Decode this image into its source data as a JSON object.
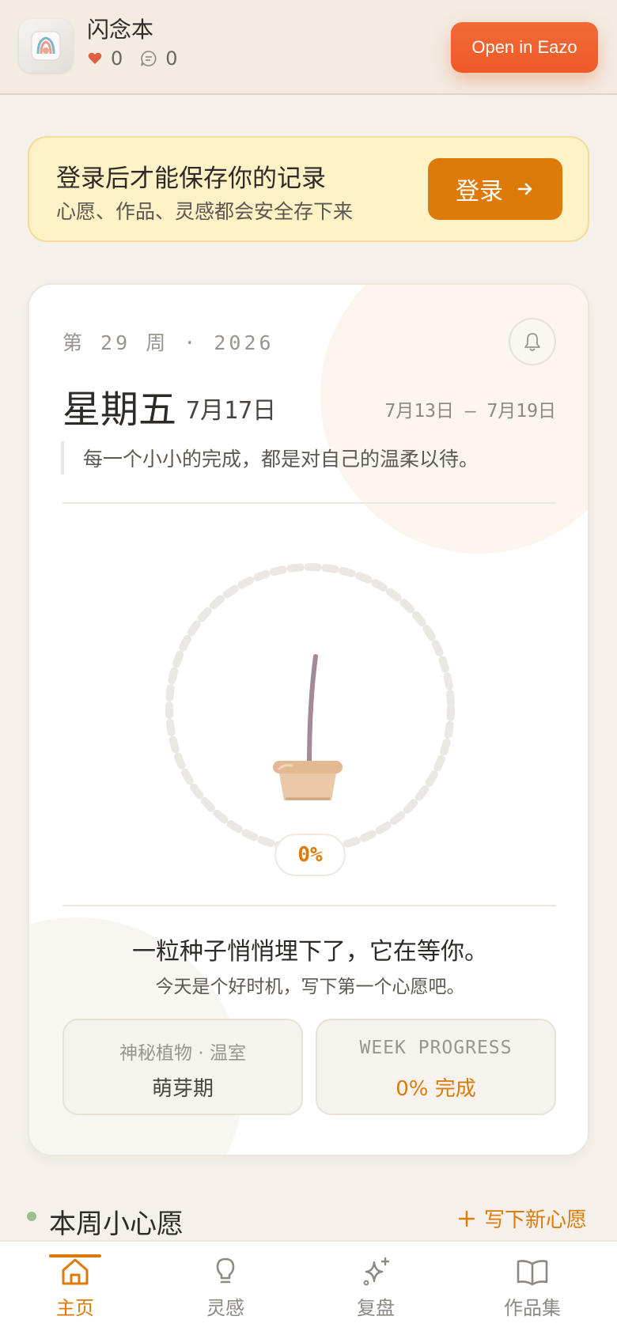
{
  "header": {
    "app_name": "闪念本",
    "likes": "0",
    "comments": "0",
    "open_button": "Open in Eazo"
  },
  "login_banner": {
    "title": "登录后才能保存你的记录",
    "subtitle": "心愿、作品、灵感都会安全存下来",
    "button": "登录"
  },
  "week_card": {
    "week_label": "第 29 周 · 2026",
    "weekday": "星期五",
    "date": "7月17日",
    "range": "7月13日 — 7月19日",
    "quote": "每一个小小的完成，都是对自己的温柔以待。",
    "progress_label": "0%",
    "progress_value": 0,
    "seed_title": "一粒种子悄悄埋下了，它在等你。",
    "seed_sub": "今天是个好时机，写下第一个心愿吧。",
    "plant_box": {
      "label": "神秘植物 · 温室",
      "value": "萌芽期"
    },
    "progress_box": {
      "label": "WEEK PROGRESS",
      "value": "0% 完成"
    }
  },
  "wishes_section": {
    "title": "本周小心愿",
    "new_button": "写下新心愿"
  },
  "nav": {
    "items": [
      {
        "label": "主页",
        "icon": "home-icon",
        "active": true
      },
      {
        "label": "灵感",
        "icon": "lightbulb-icon",
        "active": false
      },
      {
        "label": "复盘",
        "icon": "sparkle-icon",
        "active": false
      },
      {
        "label": "作品集",
        "icon": "book-icon",
        "active": false
      }
    ]
  },
  "colors": {
    "accent": "#dd7a08",
    "open_button": "#ee5a28",
    "banner_bg": "#fdf1c6",
    "background": "#f5f1ea"
  }
}
